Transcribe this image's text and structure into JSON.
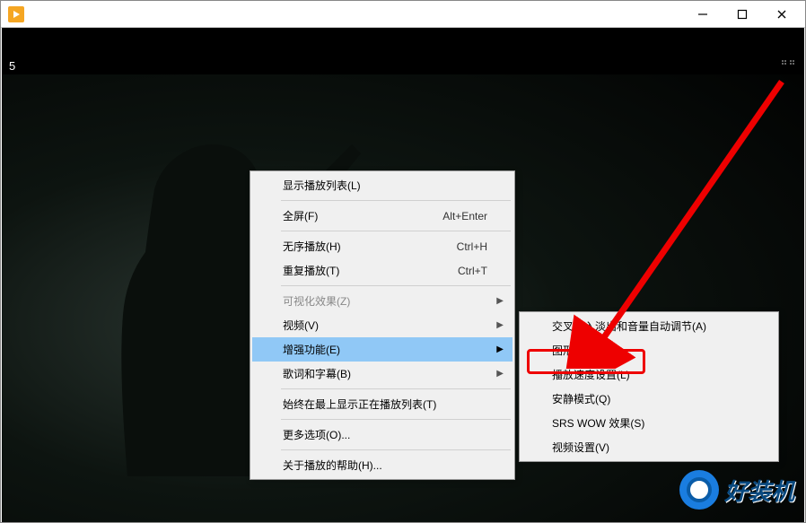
{
  "titlebar": {
    "app_icon": "media-player-icon"
  },
  "video": {
    "timestamp": "5"
  },
  "menu": {
    "show_playlist": "显示播放列表(L)",
    "fullscreen": "全屏(F)",
    "fullscreen_key": "Alt+Enter",
    "shuffle": "无序播放(H)",
    "shuffle_key": "Ctrl+H",
    "repeat": "重复播放(T)",
    "repeat_key": "Ctrl+T",
    "visual_fx": "可视化效果(Z)",
    "video": "视频(V)",
    "enhance": "增强功能(E)",
    "lyrics": "歌词和字幕(B)",
    "always_top": "始终在最上显示正在播放列表(T)",
    "more_options": "更多选项(O)...",
    "about_help": "关于播放的帮助(H)..."
  },
  "submenu": {
    "crossfade": "交叉淡入淡出和音量自动调节(A)",
    "equalizer": "图形均衡器(G)",
    "speed": "播放速度设置(L)",
    "quiet": "安静模式(Q)",
    "srs": "SRS WOW 效果(S)",
    "video_settings": "视频设置(V)"
  },
  "watermark": {
    "text": "好装机"
  }
}
